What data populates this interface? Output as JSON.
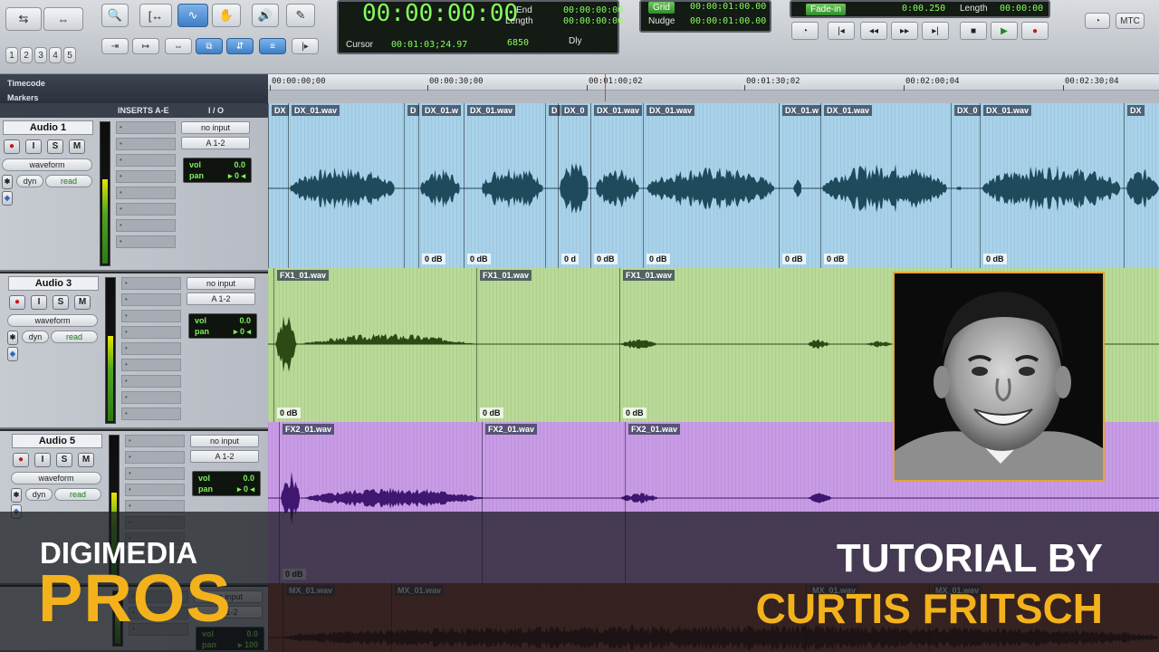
{
  "toolbar": {
    "main_counter": "00:00:00:00",
    "end_label": "End",
    "end_value": "00:00:00:00",
    "length_label": "Length",
    "length_value": "00:00:00:00",
    "cursor_label": "Cursor",
    "cursor_value": "00:01:03;24.97",
    "sample_value": "6850",
    "dly_label": "Dly",
    "grid_label": "Grid",
    "grid_value": "00:00:01:00.00",
    "nudge_label": "Nudge",
    "nudge_value": "00:00:01:00.00",
    "fade_label": "Fade-in",
    "fade_value": "0:00.250",
    "length2_label": "Length",
    "length2_value": "00:00:00",
    "mtc_label": "MTC",
    "zoom_presets": [
      "1",
      "2",
      "3",
      "4",
      "5"
    ]
  },
  "rulers": {
    "timecode_label": "Timecode",
    "markers_label": "Markers",
    "ticks": [
      "00:00:00;00",
      "00:00:30;00",
      "00:01:00;02",
      "00:01:30;02",
      "00:02:00;04",
      "00:02:30;04"
    ]
  },
  "columns": {
    "inserts": "INSERTS A-E",
    "io": "I / O"
  },
  "tracks": [
    {
      "name": "Audio 1",
      "view": "waveform",
      "auto_a": "dyn",
      "auto_b": "read",
      "input": "no input",
      "output": "A 1-2",
      "vol_label": "vol",
      "vol": "0.0",
      "pan_label": "pan",
      "pan": "▸ 0 ◂"
    },
    {
      "name": "Audio 3",
      "view": "waveform",
      "auto_a": "dyn",
      "auto_b": "read",
      "input": "no input",
      "output": "A 1-2",
      "vol_label": "vol",
      "vol": "0.0",
      "pan_label": "pan",
      "pan": "▸ 0 ◂"
    },
    {
      "name": "Audio 5",
      "view": "waveform",
      "auto_a": "dyn",
      "auto_b": "read",
      "input": "no input",
      "output": "A 1-2",
      "vol_label": "vol",
      "vol": "0.0",
      "pan_label": "pan",
      "pan": "▸ 0 ◂"
    },
    {
      "name": "",
      "view": "",
      "auto_a": "",
      "auto_b": "",
      "input": "no input",
      "output": "A 1-2",
      "vol_label": "vol",
      "vol": "0.0",
      "pan_label": "pan",
      "pan": "▸ 100"
    }
  ],
  "clips": {
    "dx": [
      {
        "name": "DX",
        "gain": ""
      },
      {
        "name": "DX_01.wav",
        "gain": ""
      },
      {
        "name": "D",
        "gain": ""
      },
      {
        "name": "DX_01.w",
        "gain": "0 dB"
      },
      {
        "name": "DX_01.wav",
        "gain": "0 dB"
      },
      {
        "name": "D",
        "gain": ""
      },
      {
        "name": "DX_0",
        "gain": "0 d"
      },
      {
        "name": "DX_01.wav",
        "gain": "0 dB"
      },
      {
        "name": "DX_01.wav",
        "gain": "0 dB"
      },
      {
        "name": "DX_01.w",
        "gain": "0 dB"
      },
      {
        "name": "DX_01.wav",
        "gain": "0 dB"
      },
      {
        "name": "DX_0",
        "gain": ""
      },
      {
        "name": "DX_01.wav",
        "gain": "0 dB"
      },
      {
        "name": "DX",
        "gain": ""
      }
    ],
    "dx_first_gain": "0 dB",
    "fx1": [
      {
        "name": "FX1_01.wav",
        "gain": "0 dB"
      },
      {
        "name": "FX1_01.wav",
        "gain": "0 dB"
      },
      {
        "name": "FX1_01.wav",
        "gain": "0 dB"
      }
    ],
    "fx2": [
      {
        "name": "FX2_01.wav",
        "gain": "0 dB"
      },
      {
        "name": "FX2_01.wav",
        "gain": ""
      },
      {
        "name": "FX2_01.wav",
        "gain": ""
      }
    ],
    "mx": [
      {
        "name": "MX_01.wav",
        "gain": ""
      },
      {
        "name": "MX_01.wav",
        "gain": ""
      },
      {
        "name": "MX_01.wav",
        "gain": ""
      },
      {
        "name": "MX_01.wav",
        "gain": ""
      }
    ]
  },
  "overlay": {
    "brand_top": "DIGIMEDIA",
    "brand_bottom": "PROS",
    "tutorial_line": "TUTORIAL BY",
    "author": "CURTIS FRITSCH"
  },
  "colors": {
    "dx_clip": "#a8d2ea",
    "dx_wave": "#1f4a5c",
    "fx1_clip": "#b9da97",
    "fx1_wave": "#2d4a14",
    "fx2_clip": "#c89be6",
    "fx2_wave": "#3f1670",
    "mx_clip": "#8c4034",
    "brand_accent": "#f3b21c",
    "photo_border": "#e7a33a"
  }
}
